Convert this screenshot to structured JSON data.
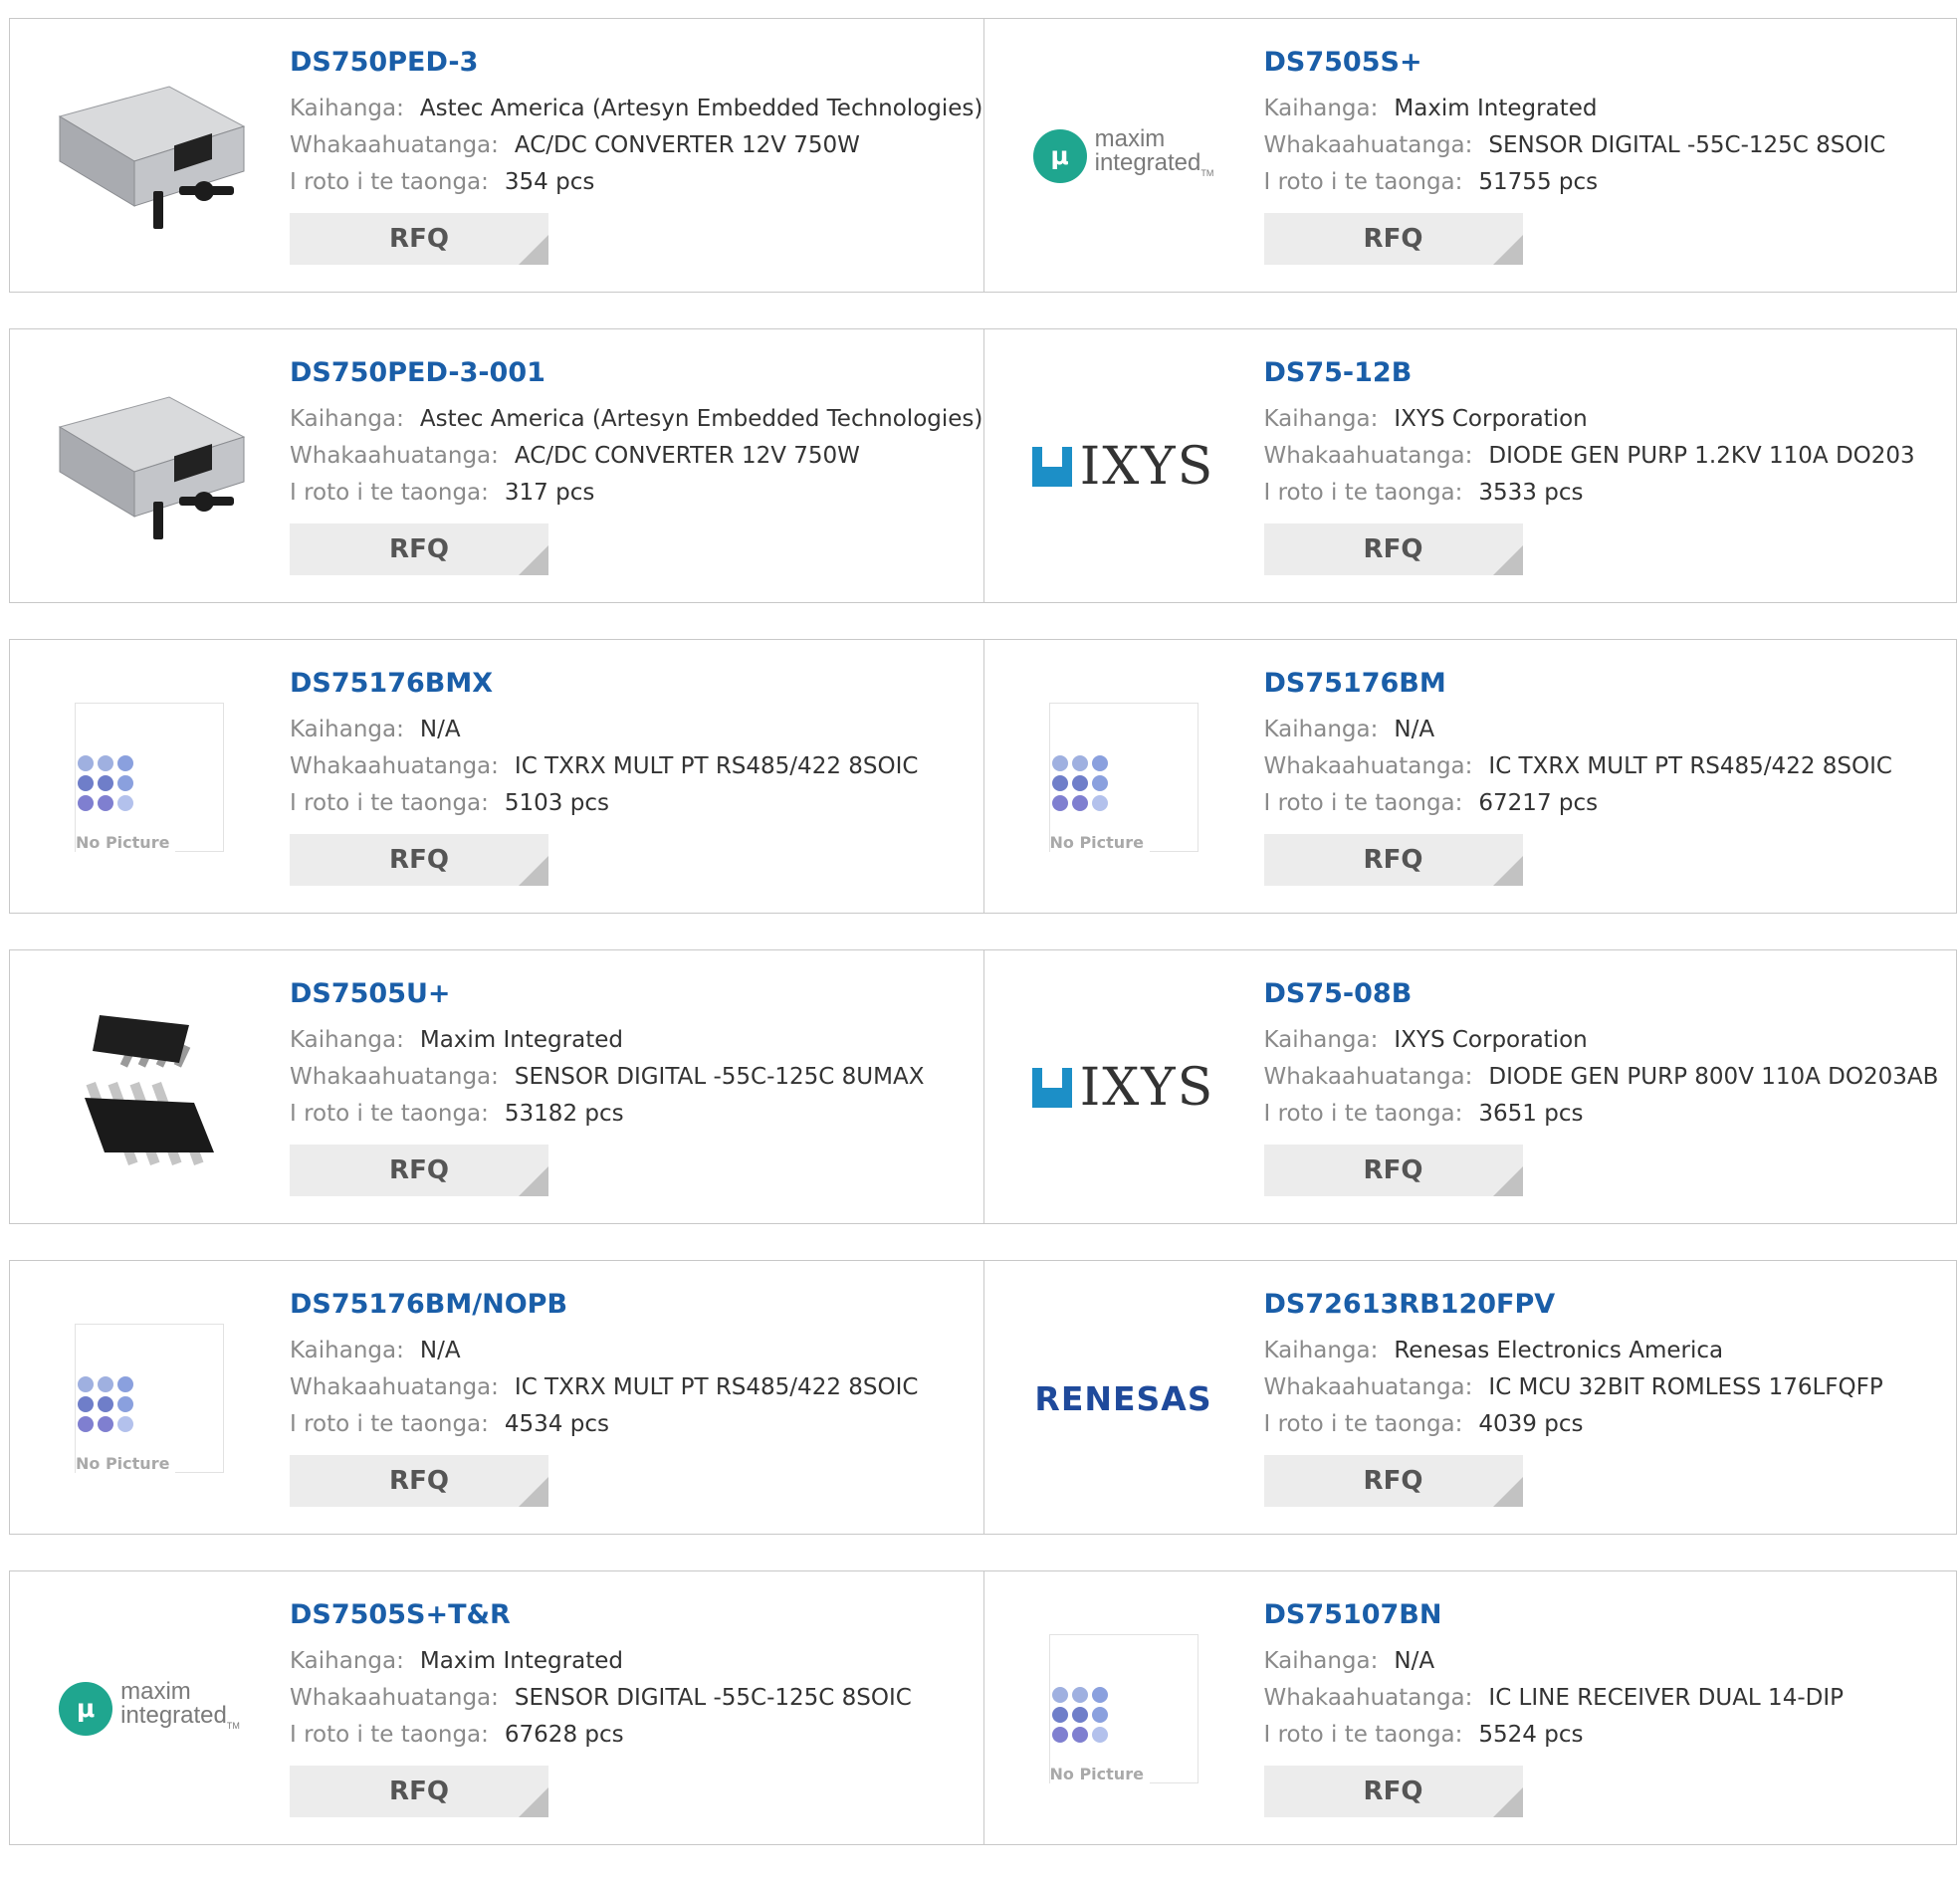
{
  "labels": {
    "manufacturer": "Kaihanga:",
    "description": "Whakaahuatanga:",
    "stock": "I roto i te taonga:",
    "rfq": "RFQ",
    "no_picture": "No Picture"
  },
  "logos": {
    "maxim_line1": "maxim",
    "maxim_line2": "integrated",
    "maxim_tm": "TM",
    "ixys": "IXYS",
    "renesas": "RENESAS"
  },
  "colors": {
    "link": "#1a5ea8",
    "maxim": "#1fa68f",
    "ixys": "#1c8fc7",
    "renesas": "#1f4a9b"
  },
  "products": [
    {
      "name": "DS750PED-3",
      "manufacturer": "Astec America (Artesyn Embedded Technologies)",
      "description": "AC/DC CONVERTER 12V 750W",
      "stock": "354 pcs",
      "image": "power-supply"
    },
    {
      "name": "DS7505S+",
      "manufacturer": "Maxim Integrated",
      "description": "SENSOR DIGITAL -55C-125C 8SOIC",
      "stock": "51755 pcs",
      "image": "maxim-logo"
    },
    {
      "name": "DS750PED-3-001",
      "manufacturer": "Astec America (Artesyn Embedded Technologies)",
      "description": "AC/DC CONVERTER 12V 750W",
      "stock": "317 pcs",
      "image": "power-supply"
    },
    {
      "name": "DS75-12B",
      "manufacturer": "IXYS Corporation",
      "description": "DIODE GEN PURP 1.2KV 110A DO203",
      "stock": "3533 pcs",
      "image": "ixys-logo"
    },
    {
      "name": "DS75176BMX",
      "manufacturer": "N/A",
      "description": "IC TXRX MULT PT RS485/422 8SOIC",
      "stock": "5103 pcs",
      "image": "no-picture"
    },
    {
      "name": "DS75176BM",
      "manufacturer": "N/A",
      "description": "IC TXRX MULT PT RS485/422 8SOIC",
      "stock": "67217 pcs",
      "image": "no-picture"
    },
    {
      "name": "DS7505U+",
      "manufacturer": "Maxim Integrated",
      "description": "SENSOR DIGITAL -55C-125C 8UMAX",
      "stock": "53182 pcs",
      "image": "chip"
    },
    {
      "name": "DS75-08B",
      "manufacturer": "IXYS Corporation",
      "description": "DIODE GEN PURP 800V 110A DO203AB",
      "stock": "3651 pcs",
      "image": "ixys-logo"
    },
    {
      "name": "DS75176BM/NOPB",
      "manufacturer": "N/A",
      "description": "IC TXRX MULT PT RS485/422 8SOIC",
      "stock": "4534 pcs",
      "image": "no-picture"
    },
    {
      "name": "DS72613RB120FPV",
      "manufacturer": "Renesas Electronics America",
      "description": "IC MCU 32BIT ROMLESS 176LFQFP",
      "stock": "4039 pcs",
      "image": "renesas-logo"
    },
    {
      "name": "DS7505S+T&R",
      "manufacturer": "Maxim Integrated",
      "description": "SENSOR DIGITAL -55C-125C 8SOIC",
      "stock": "67628 pcs",
      "image": "maxim-logo"
    },
    {
      "name": "DS75107BN",
      "manufacturer": "N/A",
      "description": "IC LINE RECEIVER DUAL 14-DIP",
      "stock": "5524 pcs",
      "image": "no-picture"
    }
  ]
}
